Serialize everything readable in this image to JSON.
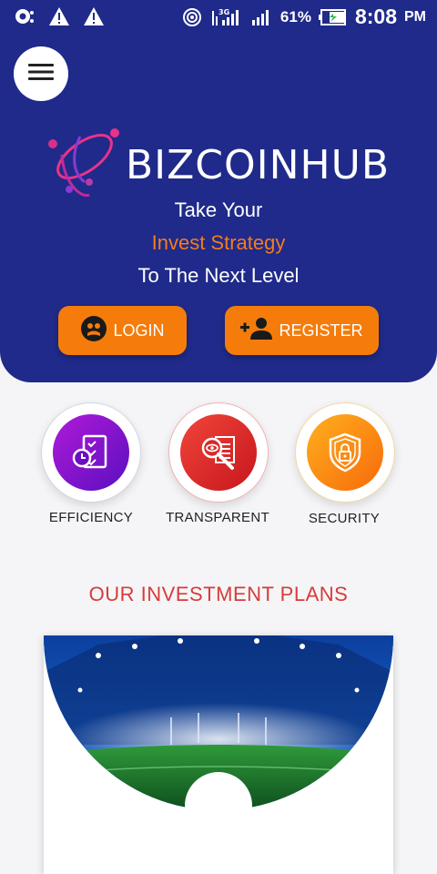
{
  "status": {
    "battery": "61%",
    "time": "8:08",
    "ampm": "PM",
    "network": "3G"
  },
  "brand": {
    "name": "BIZCOINHUB"
  },
  "tagline": {
    "line1": "Take Your",
    "line2": "Invest Strategy",
    "line3": "To The Next Level"
  },
  "actions": {
    "login": "LOGIN",
    "register": "REGISTER"
  },
  "features": [
    {
      "label": "EFFICIENCY",
      "icon": "checklist-clock-icon"
    },
    {
      "label": "TRANSPARENT",
      "icon": "magnify-eye-icon"
    },
    {
      "label": "SECURITY",
      "icon": "shield-lock-icon"
    }
  ],
  "plans": {
    "title": "OUR INVESTMENT PLANS"
  },
  "colors": {
    "primary": "#1f2a8a",
    "accent": "#f57c0b",
    "title_red": "#d93a3a"
  }
}
